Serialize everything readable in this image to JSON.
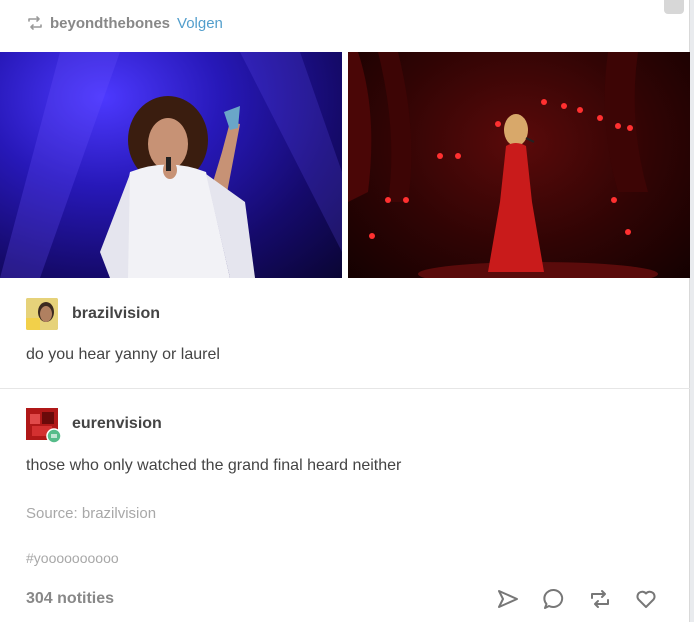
{
  "header": {
    "reblogged_from": "beyondthebones",
    "follow_label": "Volgen"
  },
  "photos": {
    "left_alt": "",
    "right_alt": ""
  },
  "replies": [
    {
      "username": "brazilvision",
      "text": "do you hear yanny or laurel"
    },
    {
      "username": "eurenvision",
      "text": "those who only watched the grand final heard neither"
    }
  ],
  "source": "Source: brazilvision",
  "tags": "#yoooooooooo",
  "notes": "304 notities",
  "actions": [
    "share-icon",
    "reply-icon",
    "reblog-icon",
    "like-icon"
  ],
  "colors": {
    "follow": "#529ecc",
    "muted_text": "#888888",
    "body_text": "#444444"
  }
}
